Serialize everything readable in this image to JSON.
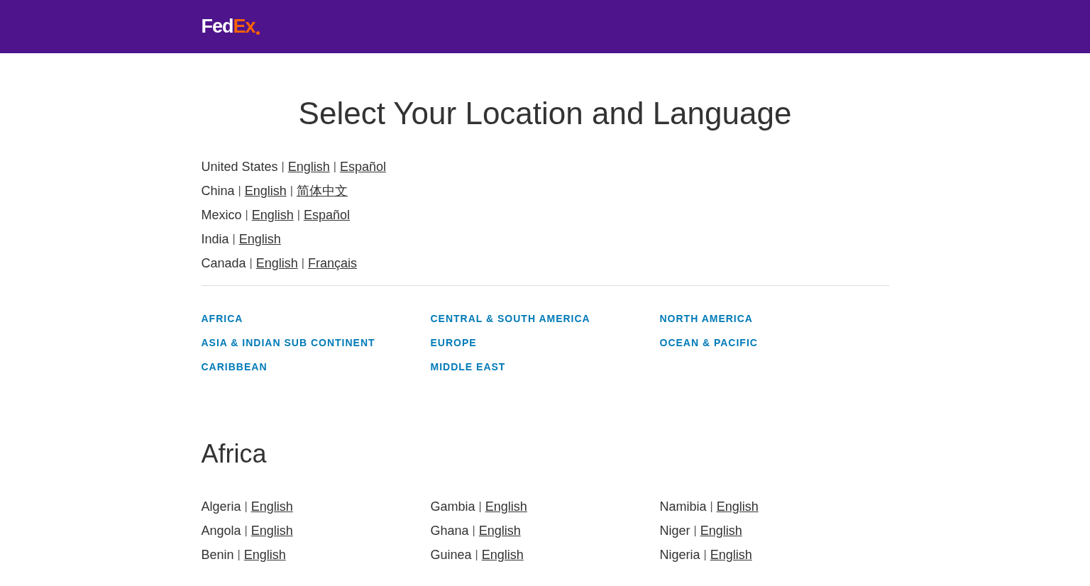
{
  "header": {
    "logo_primary": "Fed",
    "logo_accent": "Ex"
  },
  "title": "Select Your Location and Language",
  "separator": "|",
  "featured": [
    {
      "country": "United States",
      "languages": [
        "English",
        "Español"
      ]
    },
    {
      "country": "China",
      "languages": [
        "English",
        "简体中文"
      ]
    },
    {
      "country": "Mexico",
      "languages": [
        "English",
        "Español"
      ]
    },
    {
      "country": "India",
      "languages": [
        "English"
      ]
    },
    {
      "country": "Canada",
      "languages": [
        "English",
        "Français"
      ]
    }
  ],
  "regions": [
    "AFRICA",
    "CENTRAL & SOUTH AMERICA",
    "NORTH AMERICA",
    "ASIA & INDIAN SUB CONTINENT",
    "EUROPE",
    "OCEAN & PACIFIC",
    "CARIBBEAN",
    "MIDDLE EAST"
  ],
  "section": {
    "heading": "Africa",
    "columns": [
      [
        {
          "country": "Algeria",
          "languages": [
            "English"
          ]
        },
        {
          "country": "Angola",
          "languages": [
            "English"
          ]
        },
        {
          "country": "Benin",
          "languages": [
            "English"
          ]
        }
      ],
      [
        {
          "country": "Gambia",
          "languages": [
            "English"
          ]
        },
        {
          "country": "Ghana",
          "languages": [
            "English"
          ]
        },
        {
          "country": "Guinea",
          "languages": [
            "English"
          ]
        }
      ],
      [
        {
          "country": "Namibia",
          "languages": [
            "English"
          ]
        },
        {
          "country": "Niger",
          "languages": [
            "English"
          ]
        },
        {
          "country": "Nigeria",
          "languages": [
            "English"
          ]
        }
      ]
    ]
  }
}
